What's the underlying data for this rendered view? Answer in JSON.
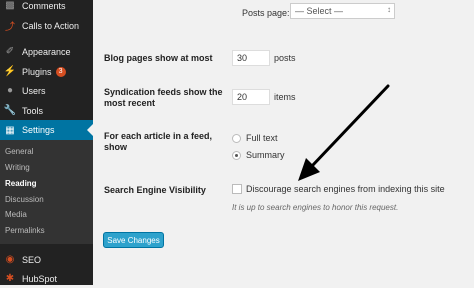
{
  "sidebar": {
    "items": [
      {
        "label": "Comments",
        "icon": "comments-icon"
      },
      {
        "label": "Calls to Action",
        "icon": "calls-to-action-icon"
      },
      {
        "label": "Appearance",
        "icon": "appearance-icon"
      },
      {
        "label": "Plugins",
        "icon": "plugins-icon",
        "badge": "3"
      },
      {
        "label": "Users",
        "icon": "users-icon"
      },
      {
        "label": "Tools",
        "icon": "tools-icon"
      },
      {
        "label": "Settings",
        "icon": "settings-icon"
      },
      {
        "label": "SEO",
        "icon": "seo-icon"
      },
      {
        "label": "HubSpot",
        "icon": "hubspot-icon"
      }
    ],
    "submenu": [
      "General",
      "Writing",
      "Reading",
      "Discussion",
      "Media",
      "Permalinks"
    ],
    "current_submenu": "Reading"
  },
  "form": {
    "posts_page": {
      "label": "Posts page:",
      "value": "— Select —"
    },
    "blog_pages": {
      "label": "Blog pages show at most",
      "value": "30",
      "unit": "posts"
    },
    "syndication": {
      "label_line1": "Syndication feeds show the",
      "label_line2": "most recent",
      "value": "20",
      "unit": "items"
    },
    "feed_article": {
      "label_line1": "For each article in a feed,",
      "label_line2": "show",
      "options": [
        "Full text",
        "Summary"
      ],
      "selected": "Summary"
    },
    "search_visibility": {
      "label": "Search Engine Visibility",
      "checkbox_label": "Discourage search engines from indexing this site",
      "checked": false,
      "hint": "It is up to search engines to honor this request."
    },
    "save_label": "Save Changes"
  },
  "colors": {
    "sidebar_bg": "#222222",
    "active_bg": "#0074a2",
    "button_bg": "#2ea2cc",
    "badge_bg": "#d54e21"
  }
}
